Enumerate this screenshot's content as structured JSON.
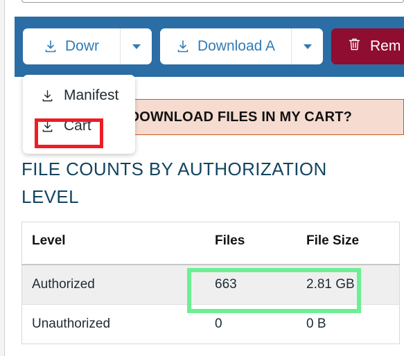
{
  "toolbar": {
    "background_color": "#2b6da5",
    "buttons": [
      {
        "label": "Dowr",
        "icon": "download-icon",
        "has_caret": true
      },
      {
        "label": "Download A",
        "icon": "download-icon",
        "has_caret": true
      }
    ],
    "remove_button": {
      "label": "Rem",
      "icon": "trash-icon",
      "color": "#8e0d30"
    }
  },
  "dropdown": {
    "items": [
      {
        "label": "Manifest",
        "icon": "download-icon",
        "highlighted": false
      },
      {
        "label": "Cart",
        "icon": "download-icon",
        "highlighted": true
      }
    ],
    "highlight_color": "#ee1c25"
  },
  "alert": {
    "text": "TO DOWNLOAD FILES IN MY CART?",
    "background_color": "#f6dcd0",
    "border_color": "#c85a1e"
  },
  "section": {
    "heading": "FILE COUNTS BY AUTHORIZATION LEVEL",
    "heading_color": "#13445f"
  },
  "table": {
    "columns": [
      "Level",
      "Files",
      "File Size"
    ],
    "rows": [
      {
        "level": "Authorized",
        "files": "663",
        "file_size": "2.81 GB",
        "highlighted": true
      },
      {
        "level": "Unauthorized",
        "files": "0",
        "file_size": "0 B",
        "highlighted": false
      }
    ],
    "highlight_color": "#6bef94"
  }
}
